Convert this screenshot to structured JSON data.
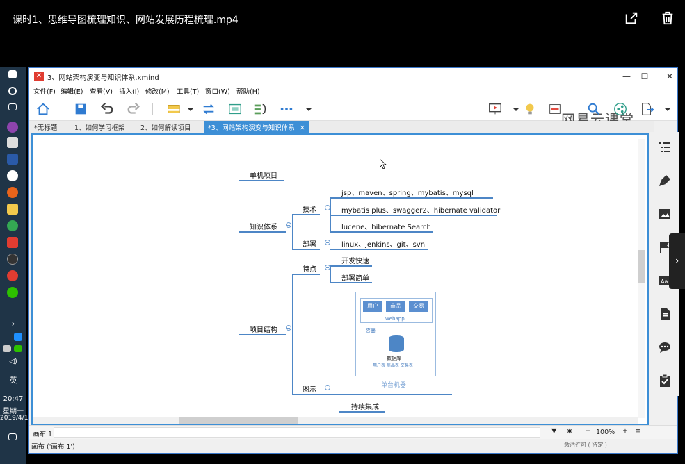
{
  "video": {
    "title": "课时1、思维导图梳理知识、网站发展历程梳理.mp4"
  },
  "taskbar": {
    "time": "20:47",
    "weekday": "星期一",
    "date": "2019/4/1",
    "ime": "英"
  },
  "window": {
    "title": "3、网站架构演变与知识体系.xmind",
    "minimize": "—",
    "maximize": "☐",
    "close": "✕"
  },
  "menu": [
    "文件(F)",
    "编辑(E)",
    "查看(V)",
    "插入(I)",
    "修改(M)",
    "工具(T)",
    "窗口(W)",
    "帮助(H)"
  ],
  "brand": "网易云课堂",
  "tabs": [
    "*无标题",
    "1、如何学习框架",
    "2、如何解读项目",
    "*3、网站架构演变与知识体系"
  ],
  "tab_close": "✕",
  "mindmap": {
    "standalone": "单机项目",
    "knowledge": "知识体系",
    "tech": "技术",
    "tech_items": [
      "jsp、maven、spring、mybatis、mysql",
      "mybatis plus、swagger2、hibernate validator",
      "lucene、hibernate Search"
    ],
    "deploy": "部署",
    "deploy_item": "linux、jenkins、git、svn",
    "structure": "项目结构",
    "features": "特点",
    "feature_items": [
      "开发快速",
      "部署简单"
    ],
    "diagram_node": "图示",
    "ci": "持续集成"
  },
  "diagram": {
    "boxes": [
      "用户",
      "商品",
      "交易"
    ],
    "webapp": "webapp",
    "container": "容器",
    "db": "数据库",
    "tables": "用户表  商品表  交易表",
    "machine": "单台机器"
  },
  "status": {
    "sheet": "画布 1",
    "sheet_full": "画布 ('画布 1')",
    "zoom": "100%",
    "minus": "−",
    "plus": "+",
    "extra": "激活许可 ( 待定 )"
  },
  "colors": {
    "accent": "#3d8fd6",
    "line": "#4d86c6",
    "taskbar": "#1f3447",
    "logo": "#e03c31"
  }
}
